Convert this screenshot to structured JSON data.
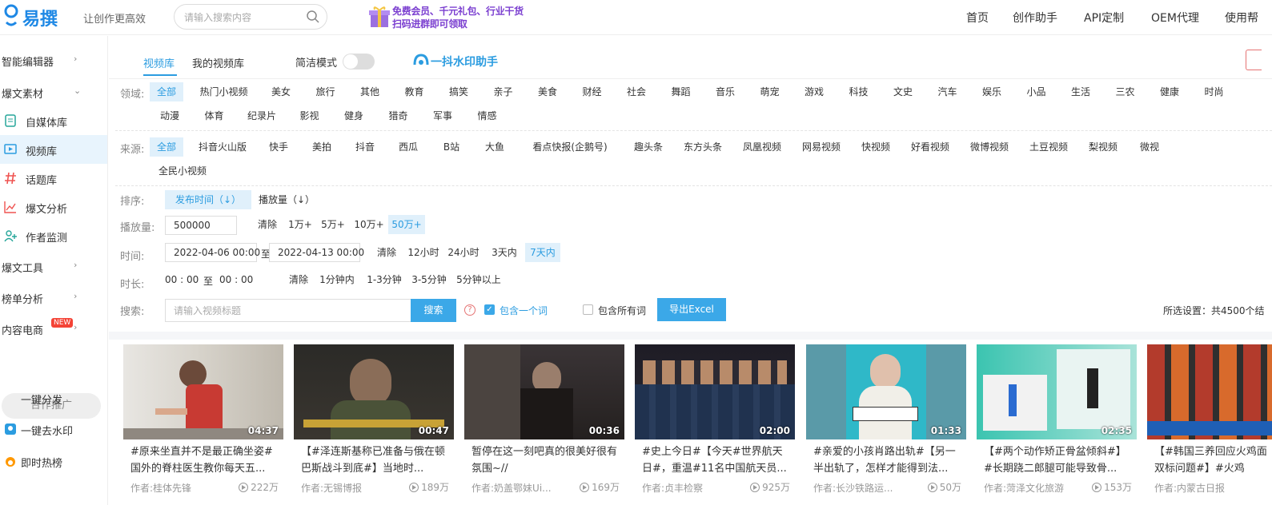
{
  "header": {
    "logo_text": "易撰",
    "slogan": "让创作更高效",
    "search_placeholder": "请输入搜索内容",
    "banner_line1": "免费会员、千元礼包、行业干货",
    "banner_line2": "扫码进群即可领取",
    "nav": [
      "首页",
      "创作助手",
      "API定制",
      "OEM代理",
      "使用帮"
    ]
  },
  "sidebar": {
    "smart_editor": "智能编辑器",
    "viral_material": "爆文素材",
    "items": [
      "自媒体库",
      "视频库",
      "话题库",
      "爆文分析",
      "作者监测"
    ],
    "viral_tools": "爆文工具",
    "rank_analysis": "榜单分析",
    "ecommerce": "内容电商",
    "new_badge": "NEW",
    "cooperation": "合作推广",
    "one_click_distribute": "一键分发",
    "one_click_watermark": "一键去水印",
    "instant_hot": "即时热榜"
  },
  "tabs": [
    "视频库",
    "我的视频库"
  ],
  "simple_mode": "简洁模式",
  "watermark_helper": "一抖水印助手",
  "filters": {
    "domain_label": "领域:",
    "domains_row1": [
      "全部",
      "热门小视频",
      "美女",
      "旅行",
      "其他",
      "教育",
      "搞笑",
      "亲子",
      "美食",
      "财经",
      "社会",
      "舞蹈",
      "音乐",
      "萌宠",
      "游戏",
      "科技",
      "文史",
      "汽车",
      "娱乐",
      "小品",
      "生活",
      "三农",
      "健康",
      "时尚"
    ],
    "domains_row2": [
      "动漫",
      "体育",
      "纪录片",
      "影视",
      "健身",
      "猎奇",
      "军事",
      "情感"
    ],
    "source_label": "来源:",
    "sources_row1": [
      "全部",
      "抖音火山版",
      "快手",
      "美拍",
      "抖音",
      "西瓜",
      "B站",
      "大鱼",
      "看点快报(企鹅号)",
      "趣头条",
      "东方头条",
      "凤凰视频",
      "网易视频",
      "快视频",
      "好看视频",
      "微博视频",
      "土豆视频",
      "梨视频",
      "微视"
    ],
    "sources_row2": [
      "全民小视频"
    ],
    "sort_label": "排序:",
    "sort_options": [
      "发布时间（↓）",
      "播放量（↓）"
    ],
    "plays_label": "播放量:",
    "plays_value": "500000",
    "plays_options": [
      "清除",
      "1万+",
      "5万+",
      "10万+",
      "50万+"
    ],
    "time_label": "时间:",
    "time_start": "2022-04-06 00:00",
    "time_to": "至",
    "time_end": "2022-04-13 00:00",
    "time_options": [
      "清除",
      "12小时",
      "24小时",
      "3天内",
      "7天内"
    ],
    "duration_label": "时长:",
    "duration_start": "00 : 00",
    "duration_to": "至",
    "duration_end": "00 : 00",
    "duration_options": [
      "清除",
      "1分钟内",
      "1-3分钟",
      "3-5分钟",
      "5分钟以上"
    ],
    "search_label": "搜索:",
    "search_placeholder": "请输入视频标题",
    "search_button": "搜索",
    "contain_one": "包含一个词",
    "contain_all": "包含所有词",
    "export_button": "导出Excel",
    "settings_summary": "所选设置：共4500个结"
  },
  "videos": [
    {
      "duration": "04:37",
      "title": "#原来坐直并不是最正确坐姿#国外的脊柱医生教你每天五...",
      "author": "作者:桂体先锋",
      "plays": "222万"
    },
    {
      "duration": "00:47",
      "title": "【#泽连斯基称已准备与俄在顿巴斯战斗到底#】当地时...",
      "author": "作者:无锡博报",
      "plays": "189万"
    },
    {
      "duration": "00:36",
      "title": "暂停在这一刻吧真的很美好很有氛围~//",
      "author": "作者:奶盖鄂妹Ui...",
      "plays": "169万"
    },
    {
      "duration": "02:00",
      "title": "#史上今日#【今天#世界航天日#，重温#11名中国航天员...",
      "author": "作者:贞丰检察",
      "plays": "925万"
    },
    {
      "duration": "01:33",
      "title": "#亲爱的小孩肖路出轨#【另一半出轨了，怎样才能得到法...",
      "author": "作者:长沙铁路运...",
      "plays": "50万"
    },
    {
      "duration": "02:35",
      "title": "【#两个动作矫正骨盆倾斜#】#长期跷二郎腿可能导致骨...",
      "author": "作者:菏泽文化旅游",
      "plays": "153万"
    },
    {
      "duration": "",
      "title": "【#韩国三养回应火鸡面双标问题#】#火鸡",
      "author": "作者:内蒙古日报",
      "plays": ""
    }
  ]
}
